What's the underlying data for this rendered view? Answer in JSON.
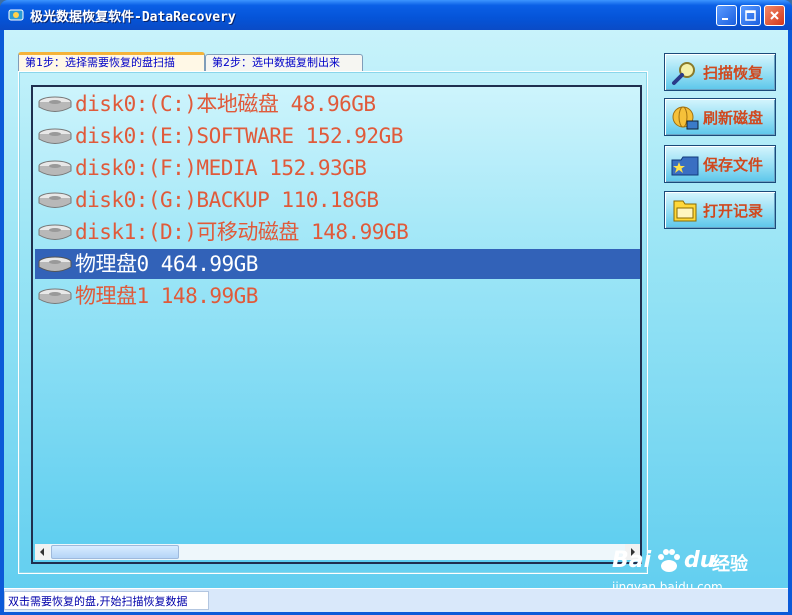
{
  "window": {
    "title": "极光数据恢复软件-DataRecovery"
  },
  "tabs": [
    {
      "label": "第1步：选择需要恢复的盘扫描"
    },
    {
      "label": "第2步：选中数据复制出来"
    }
  ],
  "disks": [
    {
      "label": "disk0:(C:)本地磁盘 48.96GB",
      "selected": false
    },
    {
      "label": "disk0:(E:)SOFTWARE 152.92GB",
      "selected": false
    },
    {
      "label": "disk0:(F:)MEDIA 152.93GB",
      "selected": false
    },
    {
      "label": "disk0:(G:)BACKUP 110.18GB",
      "selected": false
    },
    {
      "label": "disk1:(D:)可移动磁盘 148.99GB",
      "selected": false
    },
    {
      "label": "物理盘0 464.99GB",
      "selected": true
    },
    {
      "label": "物理盘1 148.99GB",
      "selected": false
    }
  ],
  "buttons": {
    "scan": "扫描恢复",
    "refresh": "刷新磁盘",
    "save": "保存文件",
    "open": "打开记录"
  },
  "status": {
    "text": "双击需要恢复的盘,开始扫描恢复数据"
  },
  "watermark": {
    "brand": "Bai",
    "brand_suffix": "du",
    "label": "经验",
    "url": "jingyan.baidu.com"
  },
  "colors": {
    "accent": "#e05a3a",
    "selection": "#3262b8",
    "titlebar": "#0554d8"
  }
}
